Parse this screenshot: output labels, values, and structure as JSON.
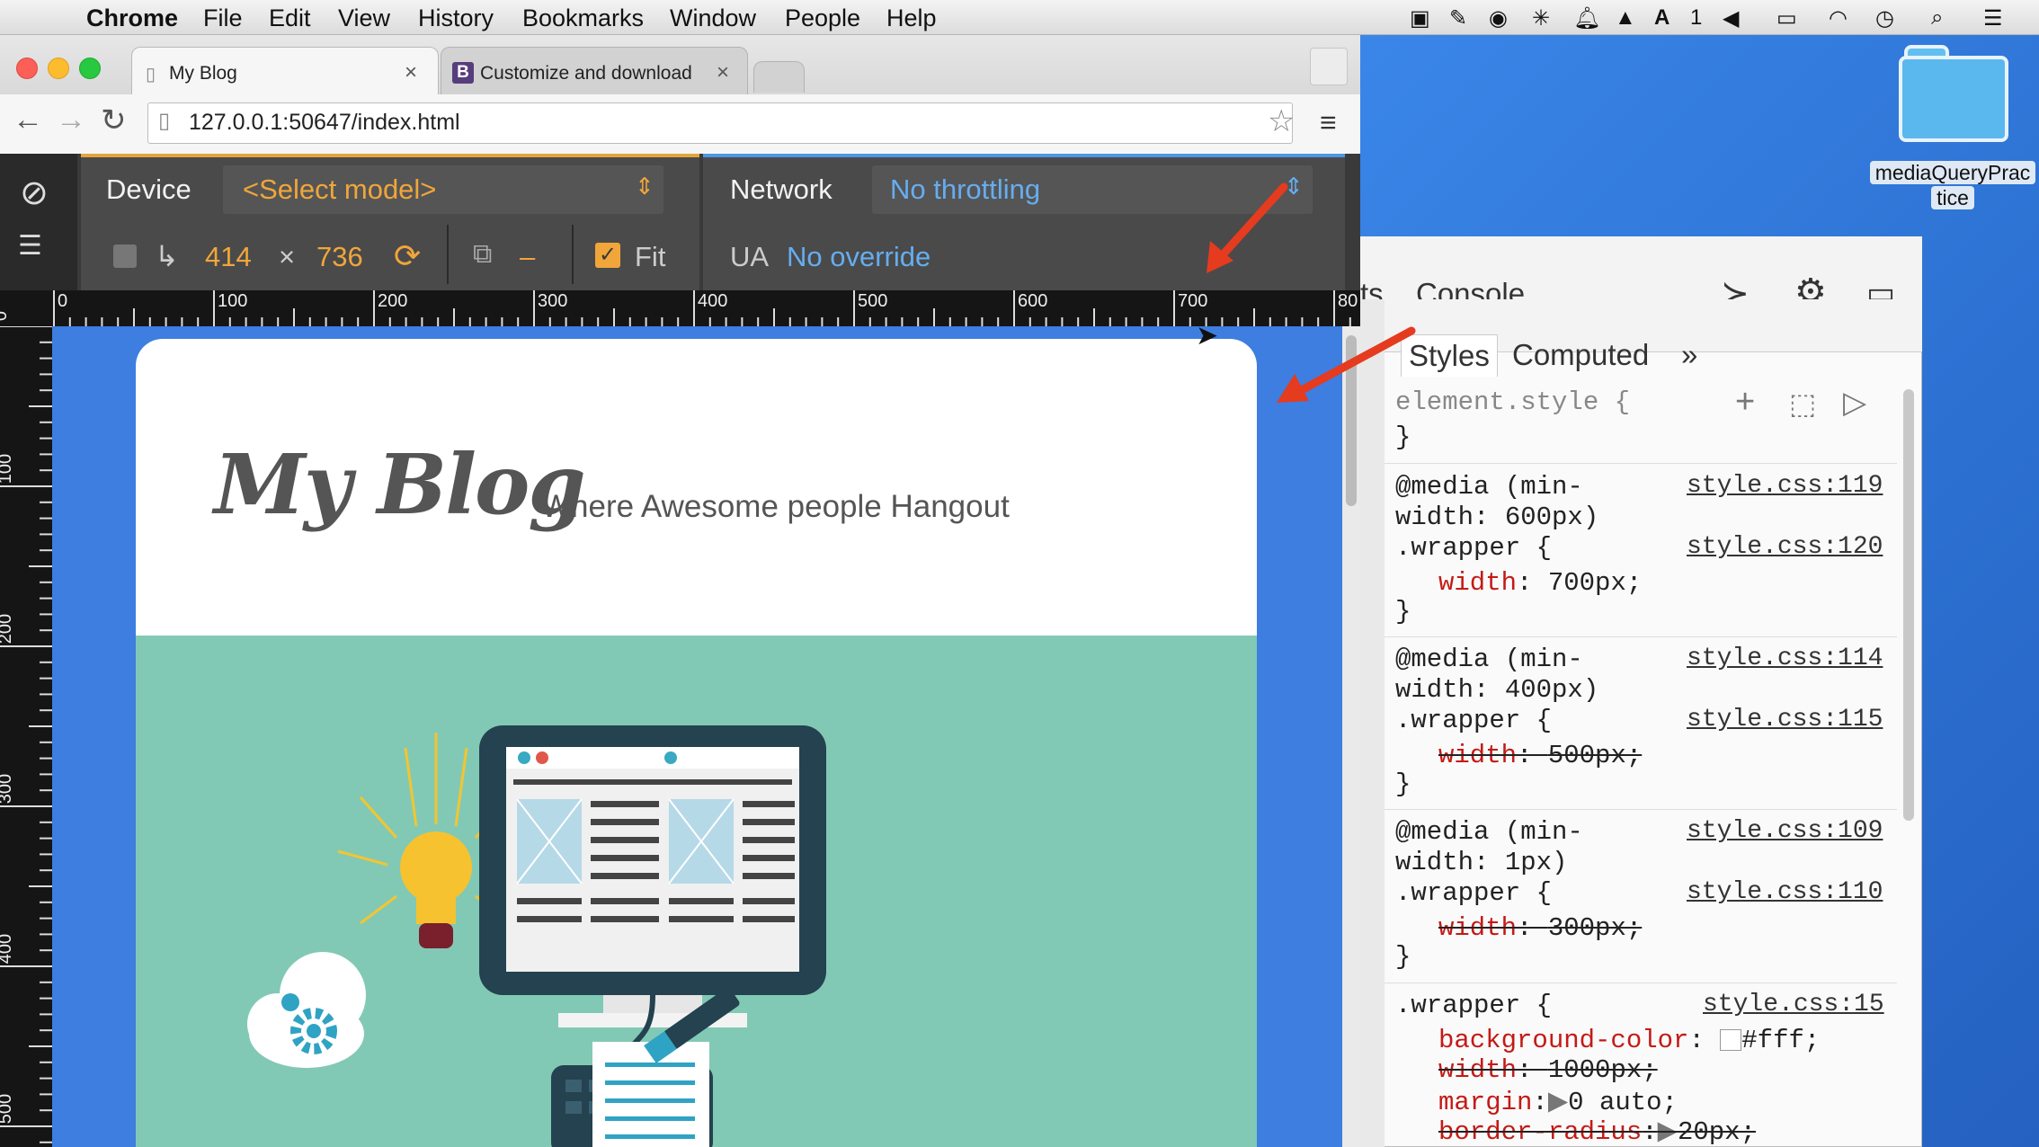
{
  "menubar": {
    "apple": "",
    "app": "Chrome",
    "items": [
      "File",
      "Edit",
      "View",
      "History",
      "Bookmarks",
      "Window",
      "People",
      "Help"
    ],
    "tray_text": "1"
  },
  "desktop": {
    "folder_label_line1": "mediaQueryPrac",
    "folder_label_line2": "tice"
  },
  "tabs": [
    {
      "title": "My Blog",
      "close": "×"
    },
    {
      "title": "Customize and download ·",
      "badge": "B",
      "close": "×"
    }
  ],
  "toolbar": {
    "url": "127.0.0.1:50647/index.html"
  },
  "emulation": {
    "device_label": "Device",
    "device_value": "<Select model>",
    "width": "414",
    "times": "×",
    "height": "736",
    "zoom_dash": "–",
    "fit_label": "Fit",
    "fit_checked": true,
    "network_label": "Network",
    "network_value": "No throttling",
    "ua_label": "UA",
    "ua_value": "No override"
  },
  "ruler": {
    "top_labels": [
      "0",
      "100",
      "200",
      "300",
      "400",
      "500",
      "600",
      "700",
      "80"
    ],
    "left_labels": [
      "0",
      "100",
      "200",
      "300",
      "400",
      "500"
    ]
  },
  "page": {
    "logo": "My Blog",
    "tagline": "Where Awesome people Hangout"
  },
  "devtools": {
    "top_tab_partial": "ts",
    "console_tab": "Console",
    "styles_tab": "Styles",
    "computed_tab": "Computed",
    "more": "»",
    "element_style": "element.style {",
    "close_brace": "}",
    "rules": [
      {
        "media1": "@media (min-",
        "media2": "width: 600px)",
        "media_src": "style.css:119",
        "selector": ".wrapper {",
        "sel_src": "style.css:120",
        "prop": "width",
        "value": "700px;",
        "struck": false
      },
      {
        "media1": "@media (min-",
        "media2": "width: 400px)",
        "media_src": "style.css:114",
        "selector": ".wrapper {",
        "sel_src": "style.css:115",
        "prop": "width",
        "value": "500px;",
        "struck": true
      },
      {
        "media1": "@media (min-",
        "media2": "width: 1px)",
        "media_src": "style.css:109",
        "selector": ".wrapper {",
        "sel_src": "style.css:110",
        "prop": "width",
        "value": "300px;",
        "struck": true
      }
    ],
    "base_rule": {
      "selector": ".wrapper {",
      "src": "style.css:15",
      "decls": [
        {
          "prop": "background-color",
          "value": "#fff;",
          "struck": false
        },
        {
          "prop": "width",
          "value": "1000px;",
          "struck": true
        },
        {
          "prop": "margin",
          "value": "0 auto;",
          "struck": false
        },
        {
          "prop": "border-radius",
          "value": "20px;",
          "struck": true
        }
      ]
    }
  },
  "colors": {
    "accent_orange": "#f0a63a",
    "accent_blue": "#66adf0",
    "hero_teal": "#82c9b5",
    "arrow_red": "#e53b1f"
  }
}
